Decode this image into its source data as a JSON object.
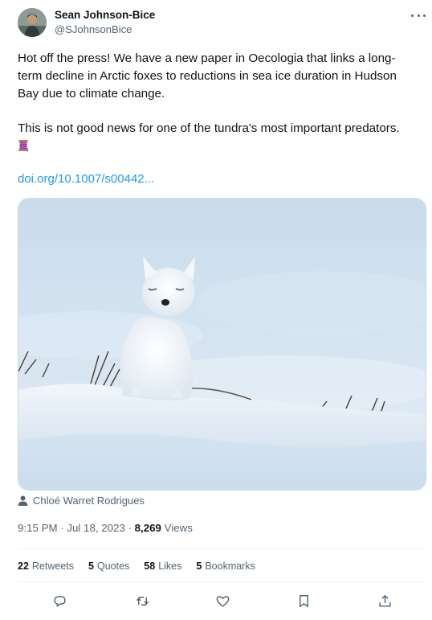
{
  "author": {
    "name": "Sean Johnson-Bice",
    "handle": "@SJohnsonBice"
  },
  "tweet": {
    "paragraph1": "Hot off the press! We have a new paper in Oecologia that links a long-term decline in Arctic foxes to reductions in sea ice duration in Hudson Bay due to climate change.",
    "paragraph2": "This is not good news for one of the tundra's most important predators.",
    "emoji": "thread-spool-emoji",
    "link_text": "doi.org/10.1007/s00442..."
  },
  "media": {
    "image": "arctic-fox-in-snow-photo",
    "credit": "Chloé Warret Rodrigues"
  },
  "meta": {
    "time": "9:15 PM",
    "separator1": " · ",
    "date": "Jul 18, 2023",
    "separator2": " · ",
    "views_count": "8,269",
    "views_label": "Views"
  },
  "stats": {
    "retweets_count": "22",
    "retweets_label": "Retweets",
    "quotes_count": "5",
    "quotes_label": "Quotes",
    "likes_count": "58",
    "likes_label": "Likes",
    "bookmarks_count": "5",
    "bookmarks_label": "Bookmarks"
  },
  "actions": [
    "reply-icon",
    "retweet-icon",
    "like-icon",
    "bookmark-icon",
    "share-icon"
  ],
  "colors": {
    "text": "#0f1419",
    "secondary": "#536471",
    "link": "#1d9bf0",
    "divider": "#eff3f4"
  }
}
